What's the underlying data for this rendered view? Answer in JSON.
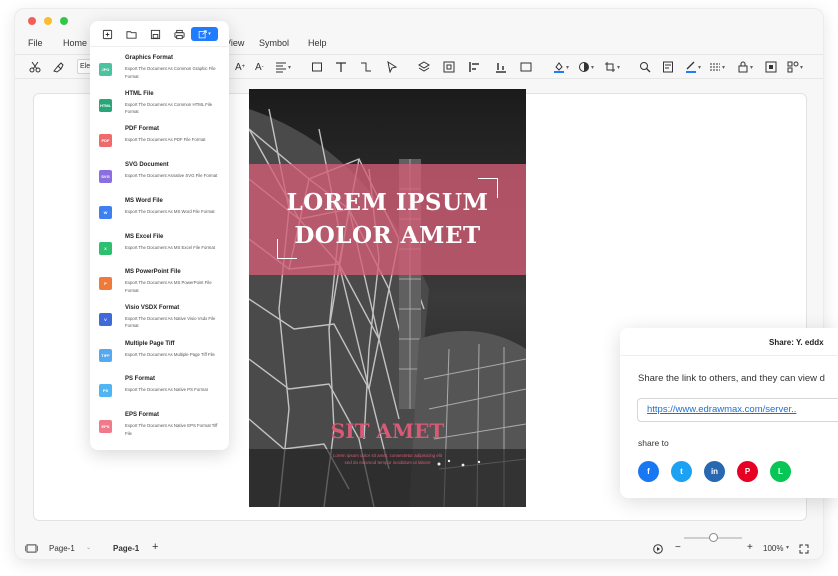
{
  "menu": [
    "File",
    "Home",
    "View",
    "Symbol",
    "Help"
  ],
  "toolbar": {
    "font_value": "Ele"
  },
  "export_panel": {
    "items": [
      {
        "icon": "JPG",
        "color": "#4bc2a0",
        "title": "Graphics Format",
        "desc": "Export The Document As Common Graphic File Format"
      },
      {
        "icon": "HTML",
        "color": "#27a67a",
        "title": "HTML File",
        "desc": "Export The Document As Common HTML File Format"
      },
      {
        "icon": "PDF",
        "color": "#ef6a6a",
        "title": "PDF Format",
        "desc": "Export The Document As PDF File Format"
      },
      {
        "icon": "SVG",
        "color": "#8b6fe0",
        "title": "SVG Document",
        "desc": "Export The Document Asnative SVG File Format"
      },
      {
        "icon": "W",
        "color": "#3f7ff0",
        "title": "MS Word File",
        "desc": "Export The Document As MS Word File Format"
      },
      {
        "icon": "X",
        "color": "#2fbf71",
        "title": "MS Excel File",
        "desc": "Export The Document As MS Excel File Format"
      },
      {
        "icon": "P",
        "color": "#f07a3a",
        "title": "MS PowerPoint File",
        "desc": "Export The Document As MS PowerPoint File Format"
      },
      {
        "icon": "V",
        "color": "#3f6ad8",
        "title": "Visio VSDX Format",
        "desc": "Export The Document As Native Visio Vsdx File Format"
      },
      {
        "icon": "TIFF",
        "color": "#56a8f0",
        "title": "Multiple Page Tiff",
        "desc": "Export The Document As Multiple Page Tiff File"
      },
      {
        "icon": "PS",
        "color": "#4fb6f2",
        "title": "PS Format",
        "desc": "Export The Document As Native PS Format"
      },
      {
        "icon": "EPS",
        "color": "#f07a8a",
        "title": "EPS Format",
        "desc": "Export The Document As Native EPS Format Tiff File"
      }
    ]
  },
  "poster": {
    "title_line1": "LOREM IPSUM",
    "title_line2": "DOLOR AMET",
    "subtitle": "SIT AMET",
    "small_line1": "Lorem ipsum dolor sit amet, consectetur adipisicing elit",
    "small_line2": "sed do eiusmod tempor incididunt ut labore"
  },
  "share": {
    "title": "Share: Y. eddx",
    "description": "Share the link to others, and they can view d",
    "link": "https://www.edrawmax.com/server..",
    "share_to": "share to",
    "socials": [
      {
        "name": "facebook",
        "glyph": "f",
        "color": "#1877f2"
      },
      {
        "name": "twitter",
        "glyph": "t",
        "color": "#1da1f2"
      },
      {
        "name": "linkedin",
        "glyph": "in",
        "color": "#2867b2"
      },
      {
        "name": "pinterest",
        "glyph": "P",
        "color": "#e60023"
      },
      {
        "name": "line",
        "glyph": "L",
        "color": "#06c755"
      }
    ]
  },
  "status": {
    "page_select": "Page-1",
    "page_tab": "Page-1",
    "add": "+",
    "zoom": "100%"
  }
}
